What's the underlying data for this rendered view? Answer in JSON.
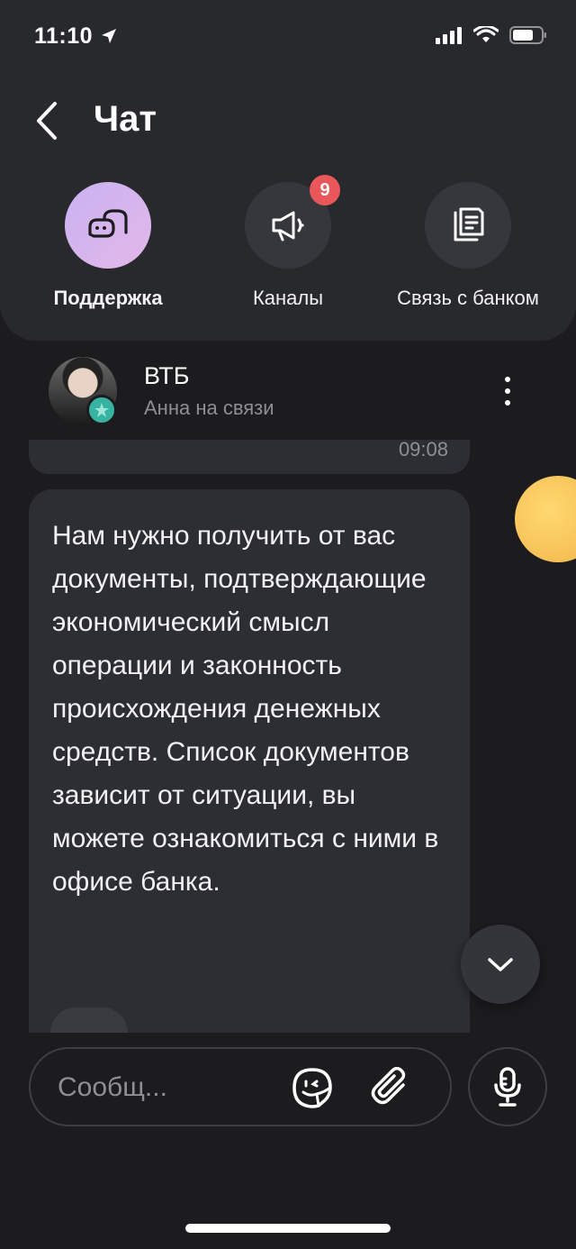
{
  "status_bar": {
    "time": "11:10"
  },
  "header": {
    "title": "Чат"
  },
  "tabs": [
    {
      "label": "Поддержка",
      "icon": "chat-bubbles-icon",
      "active": true
    },
    {
      "label": "Каналы",
      "icon": "megaphone-icon",
      "badge": "9"
    },
    {
      "label": "Связь с банком",
      "icon": "documents-icon"
    }
  ],
  "chat": {
    "name": "ВТБ",
    "status": "Анна на связи",
    "prev_time": "09:08",
    "message": "Нам нужно получить от вас документы, подтверждающие экономический смысл операции и законность происхождения денежных средств. Список документов зависит от ситуации, вы можете ознакомиться с ними в офисе банка."
  },
  "input": {
    "placeholder": "Сообщ..."
  },
  "colors": {
    "accent": "#c9b2f2",
    "badge": "#e9575a",
    "background": "#1c1c1f",
    "panel": "#28292d"
  }
}
